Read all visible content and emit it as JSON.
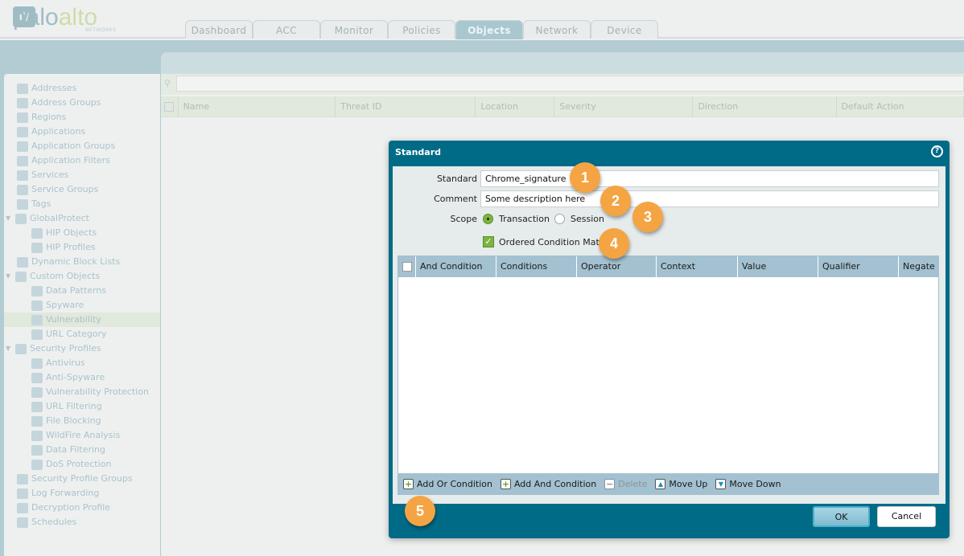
{
  "logo": {
    "text_a": "palo",
    "text_b": "alto",
    "sub": "NETWORKS"
  },
  "tabs": [
    "Dashboard",
    "ACC",
    "Monitor",
    "Policies",
    "Objects",
    "Network",
    "Device"
  ],
  "active_tab": "Objects",
  "sidebar": {
    "items": [
      {
        "label": "Addresses",
        "level": 0
      },
      {
        "label": "Address Groups",
        "level": 0
      },
      {
        "label": "Regions",
        "level": 0
      },
      {
        "label": "Applications",
        "level": 0
      },
      {
        "label": "Application Groups",
        "level": 0
      },
      {
        "label": "Application Filters",
        "level": 0
      },
      {
        "label": "Services",
        "level": 0
      },
      {
        "label": "Service Groups",
        "level": 0
      },
      {
        "label": "Tags",
        "level": 0
      },
      {
        "label": "GlobalProtect",
        "level": 0,
        "expanded": true
      },
      {
        "label": "HIP Objects",
        "level": 1
      },
      {
        "label": "HIP Profiles",
        "level": 1
      },
      {
        "label": "Dynamic Block Lists",
        "level": 0
      },
      {
        "label": "Custom Objects",
        "level": 0,
        "expanded": true
      },
      {
        "label": "Data Patterns",
        "level": 1
      },
      {
        "label": "Spyware",
        "level": 1
      },
      {
        "label": "Vulnerability",
        "level": 1,
        "selected": true
      },
      {
        "label": "URL Category",
        "level": 1
      },
      {
        "label": "Security Profiles",
        "level": 0,
        "expanded": true
      },
      {
        "label": "Antivirus",
        "level": 1
      },
      {
        "label": "Anti-Spyware",
        "level": 1
      },
      {
        "label": "Vulnerability Protection",
        "level": 1
      },
      {
        "label": "URL Filtering",
        "level": 1
      },
      {
        "label": "File Blocking",
        "level": 1
      },
      {
        "label": "WildFire Analysis",
        "level": 1
      },
      {
        "label": "Data Filtering",
        "level": 1
      },
      {
        "label": "DoS Protection",
        "level": 1
      },
      {
        "label": "Security Profile Groups",
        "level": 0
      },
      {
        "label": "Log Forwarding",
        "level": 0
      },
      {
        "label": "Decryption Profile",
        "level": 0
      },
      {
        "label": "Schedules",
        "level": 0
      }
    ]
  },
  "table": {
    "columns": [
      "Name",
      "Threat ID",
      "Location",
      "Severity",
      "Direction",
      "Default Action"
    ]
  },
  "modal": {
    "title": "Standard",
    "fields": {
      "standard_label": "Standard",
      "standard_value": "Chrome_signature",
      "comment_label": "Comment",
      "comment_value": "Some description here",
      "scope_label": "Scope",
      "scope_options": [
        "Transaction",
        "Session"
      ],
      "scope_selected": "Transaction",
      "ordered_label": "Ordered Condition Match",
      "ordered_checked": true
    },
    "grid_columns": [
      "And Condition",
      "Conditions",
      "Operator",
      "Context",
      "Value",
      "Qualifier",
      "Negate"
    ],
    "toolbar": [
      {
        "label": "Add Or Condition",
        "icon": "plus-icon",
        "enabled": true
      },
      {
        "label": "Add And Condition",
        "icon": "plus-icon",
        "enabled": true
      },
      {
        "label": "Delete",
        "icon": "minus-icon",
        "enabled": false
      },
      {
        "label": "Move Up",
        "icon": "arrow-up-icon",
        "enabled": true
      },
      {
        "label": "Move Down",
        "icon": "arrow-down-icon",
        "enabled": true
      }
    ],
    "ok": "OK",
    "cancel": "Cancel"
  },
  "callouts": [
    "1",
    "2",
    "3",
    "4",
    "5"
  ],
  "colors": {
    "modal": "#006b87",
    "callout": "#f5a443",
    "grid_header": "#a3c1d0",
    "check": "#7bb53e"
  }
}
